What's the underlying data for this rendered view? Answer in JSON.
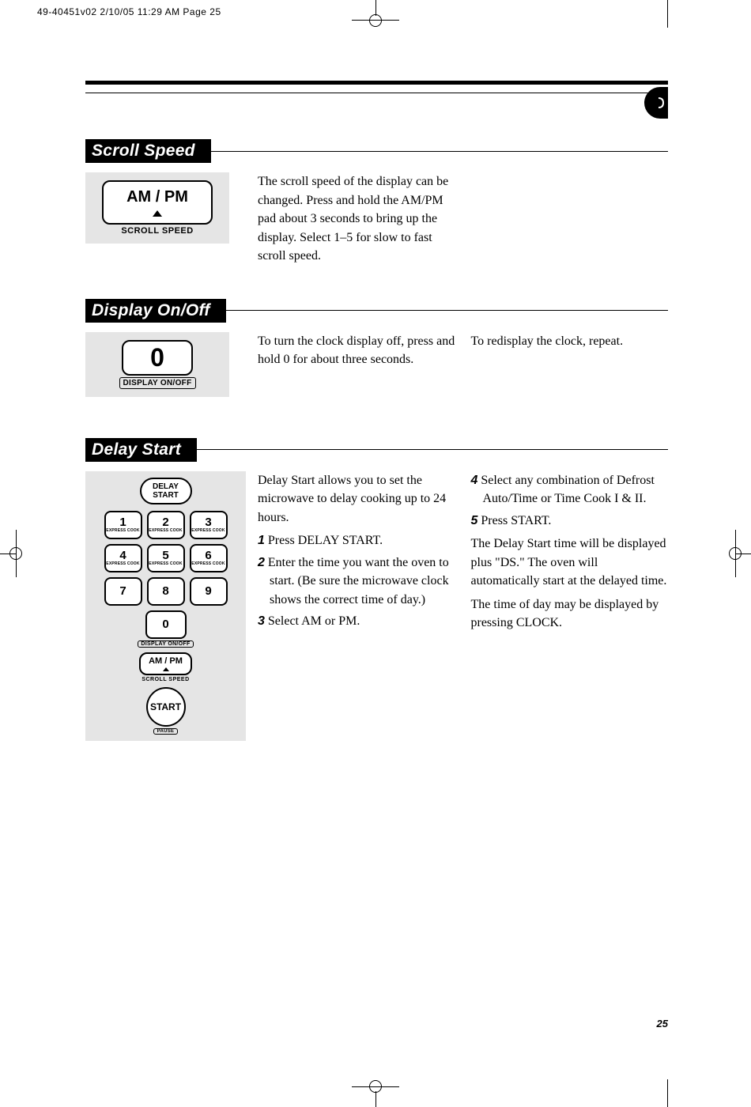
{
  "print_header": "49-40451v02  2/10/05  11:29 AM  Page 25",
  "page_number": "25",
  "sections": {
    "scroll_speed": {
      "title": "Scroll Speed",
      "diagram": {
        "button_label": "AM / PM",
        "sub_label": "SCROLL SPEED"
      },
      "col1": "The scroll speed of the display can be changed. Press and hold the AM/PM pad about 3 seconds to bring up the display. Select 1–5 for slow to fast scroll speed."
    },
    "display_onoff": {
      "title": "Display On/Off",
      "diagram": {
        "button_label": "0",
        "sub_label": "DISPLAY ON/OFF"
      },
      "col1": "To turn the clock display off, press and hold 0 for about three seconds.",
      "col2": "To redisplay the clock, repeat."
    },
    "delay_start": {
      "title": "Delay Start",
      "diagram": {
        "delay_label": "DELAY\nSTART",
        "keys": [
          "1",
          "2",
          "3",
          "4",
          "5",
          "6",
          "7",
          "8",
          "9"
        ],
        "express": "EXPRESS COOK",
        "zero": "0",
        "zero_sub": "DISPLAY ON/OFF",
        "ampm": "AM / PM",
        "scroll": "SCROLL SPEED",
        "start": "START",
        "pause": "PAUSE"
      },
      "col1_intro": "Delay Start allows you to set the microwave to delay cooking up to 24 hours.",
      "col1_steps": [
        {
          "n": "1",
          "t": "Press DELAY START."
        },
        {
          "n": "2",
          "t": "Enter the time you want the oven to start. (Be sure the microwave clock shows the correct time of day.)"
        },
        {
          "n": "3",
          "t": "Select AM or PM."
        }
      ],
      "col2_steps": [
        {
          "n": "4",
          "t": "Select any combination of Defrost Auto/Time or Time Cook I & II."
        },
        {
          "n": "5",
          "t": "Press START."
        }
      ],
      "col2_p1": "The Delay Start time will be displayed plus \"DS.\" The oven will automatically start at the delayed time.",
      "col2_p2": "The time of day may be displayed by pressing CLOCK."
    }
  }
}
